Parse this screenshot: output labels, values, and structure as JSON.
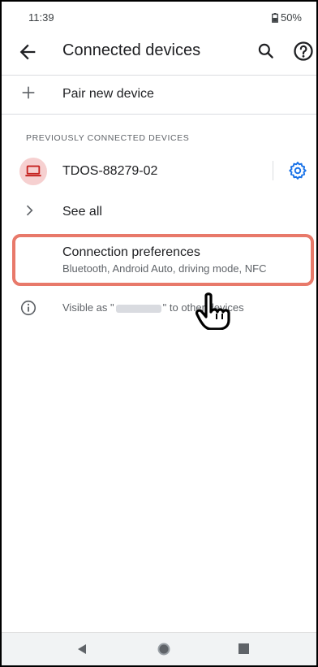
{
  "status_bar": {
    "time": "11:39",
    "battery": "50%"
  },
  "app_bar": {
    "title": "Connected devices"
  },
  "pair_new": {
    "label": "Pair new device"
  },
  "section_header": "PREVIOUSLY CONNECTED DEVICES",
  "device": {
    "name": "TDOS-88279-02"
  },
  "see_all": {
    "label": "See all"
  },
  "connection_preferences": {
    "title": "Connection preferences",
    "subtitle": "Bluetooth, Android Auto, driving mode, NFC"
  },
  "visibility": {
    "prefix": "Visible as \"",
    "suffix": "\" to other devices"
  },
  "colors": {
    "accent": "#1a73e8",
    "highlight": "#e8796a",
    "avatar_bg": "#f6d0d0",
    "avatar_icon": "#c5221f"
  },
  "icons": [
    "battery-icon",
    "back-arrow-icon",
    "search-icon",
    "help-icon",
    "plus-icon",
    "laptop-icon",
    "gear-icon",
    "chevron-right-icon",
    "info-icon",
    "hand-cursor-icon"
  ]
}
